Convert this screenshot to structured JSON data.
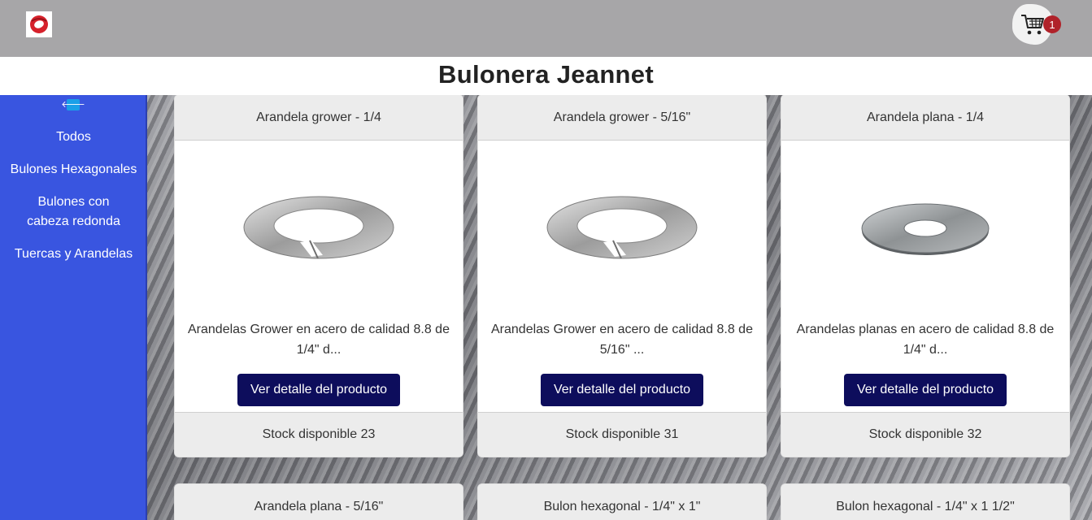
{
  "header": {
    "logo_icon": "bolt-nut-logo-icon",
    "cart_icon": "shopping-cart-icon",
    "cart_count": "1"
  },
  "brand": {
    "title": "Bulonera Jeannet"
  },
  "sidebar": {
    "collapse_icon": "arrow-left-icon",
    "items": [
      {
        "label": "Todos"
      },
      {
        "label": "Bulones Hexagonales"
      },
      {
        "label": "Bulones con cabeza redonda"
      },
      {
        "label": "Tuercas y Arandelas"
      }
    ]
  },
  "products": [
    {
      "title": "Arandela grower - 1/4",
      "description": "Arandelas Grower en acero de calidad 8.8 de 1/4\" d...",
      "button": "Ver detalle del producto",
      "stock": "Stock disponible 23",
      "image_icon": "split-lock-washer-image"
    },
    {
      "title": "Arandela grower - 5/16\"",
      "description": "Arandelas Grower en acero de calidad 8.8 de 5/16\" ...",
      "button": "Ver detalle del producto",
      "stock": "Stock disponible 31",
      "image_icon": "split-lock-washer-image"
    },
    {
      "title": "Arandela plana - 1/4",
      "description": "Arandelas planas en acero de calidad 8.8 de 1/4\" d...",
      "button": "Ver detalle del producto",
      "stock": "Stock disponible 32",
      "image_icon": "flat-washer-image"
    },
    {
      "title": "Arandela plana - 5/16\""
    },
    {
      "title": "Bulon hexagonal - 1/4\" x 1\""
    },
    {
      "title": "Bulon hexagonal - 1/4\" x 1 1/2\""
    }
  ],
  "colors": {
    "navbar": "#a7a6a8",
    "sidebar": "#3955e0",
    "button": "#0d0d5c",
    "badge": "#b0222a"
  }
}
